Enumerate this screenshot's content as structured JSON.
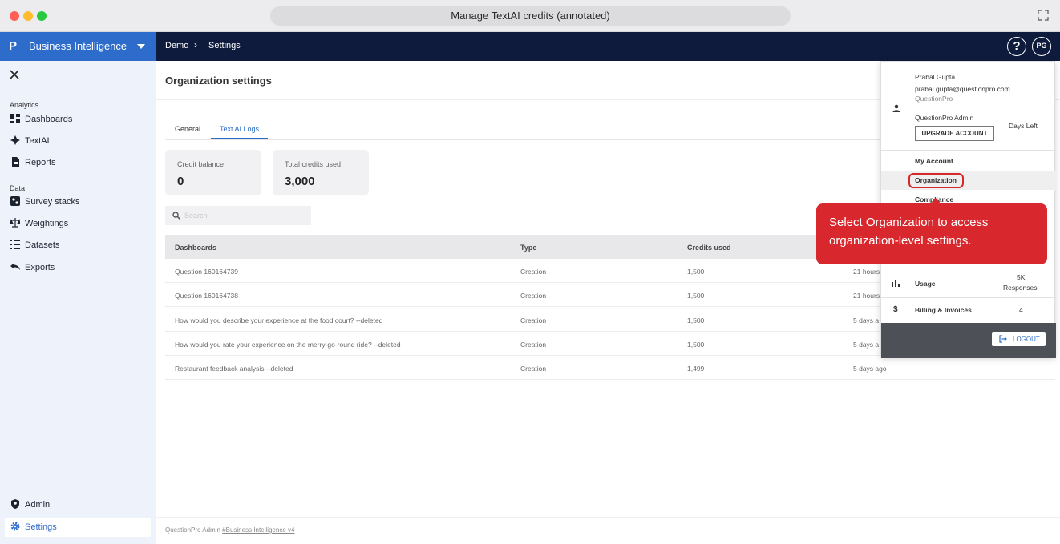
{
  "window": {
    "title": "Manage TextAI credits (annotated)"
  },
  "header": {
    "brand_logo": "P",
    "brand_label": "Business Intelligence",
    "breadcrumb": [
      "Demo",
      "Settings"
    ],
    "help_label": "?",
    "avatar_initials": "PG"
  },
  "sidebar": {
    "sections": [
      {
        "label": "Analytics"
      },
      {
        "label": "Data"
      }
    ],
    "items": [
      {
        "label": "Dashboards",
        "icon": "dashboard-icon"
      },
      {
        "label": "TextAI",
        "icon": "sparkle-icon"
      },
      {
        "label": "Reports",
        "icon": "report-icon"
      },
      {
        "label": "Survey stacks",
        "icon": "stack-icon"
      },
      {
        "label": "Weightings",
        "icon": "scale-icon"
      },
      {
        "label": "Datasets",
        "icon": "list-icon"
      },
      {
        "label": "Exports",
        "icon": "share-icon"
      }
    ],
    "bottom": [
      {
        "label": "Admin",
        "icon": "admin-icon"
      },
      {
        "label": "Settings",
        "icon": "gear-icon",
        "active": true
      }
    ]
  },
  "main": {
    "title": "Organization settings",
    "tabs": [
      {
        "label": "General"
      },
      {
        "label": "Text AI Logs",
        "active": true
      }
    ],
    "cards": [
      {
        "label": "Credit balance",
        "value": "0"
      },
      {
        "label": "Total credits used",
        "value": "3,000"
      }
    ],
    "search_placeholder": "Search",
    "table": {
      "headers": [
        "Dashboards",
        "Type",
        "Credits used",
        ""
      ],
      "rows": [
        [
          "Question 160164739",
          "Creation",
          "1,500",
          "21 hours"
        ],
        [
          "Question 160164738",
          "Creation",
          "1,500",
          "21 hours"
        ],
        [
          "How would you describe your experience at the food court? --deleted",
          "Creation",
          "1,500",
          "5 days a"
        ],
        [
          "How would you rate your experience on the merry-go-round ride? --deleted",
          "Creation",
          "1,500",
          "5 days a"
        ],
        [
          "Restaurant feedback analysis --deleted",
          "Creation",
          "1,499",
          "5 days ago"
        ]
      ]
    },
    "footer_prefix": "QuestionPro Admin ",
    "footer_link": "#Business Intelligence v4"
  },
  "dropdown": {
    "name": "Prabal Gupta",
    "email": "prabal.gupta@questionpro.com",
    "org": "QuestionPro",
    "plan": "QuestionPro Admin",
    "days_left": "Days Left",
    "upgrade_label": "UPGRADE ACCOUNT",
    "menu": [
      "My Account",
      "Organization",
      "Compliance"
    ],
    "usage_label": "Usage",
    "usage_value_1": "5K",
    "usage_value_2": "Responses",
    "billing_label": "Billing & Invoices",
    "billing_value": "4",
    "billing_icon": "$",
    "logout_label": "LOGOUT"
  },
  "annotation": {
    "text": "Select Organization to access organization-level settings.",
    "color": "#d8282d"
  },
  "colors": {
    "navy": "#0f1b3d",
    "brand_blue": "#2d6ccb",
    "sidebar_bg": "#eef2fb"
  }
}
